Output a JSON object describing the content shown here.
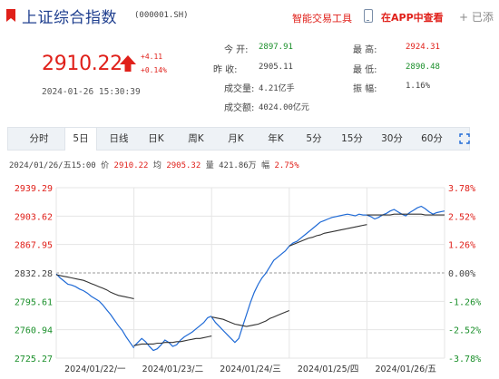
{
  "header": {
    "title": "上证综合指数",
    "code": "(000001.SH)",
    "smart_tool": "智能交易工具",
    "app_link": "在APP中查看",
    "add_label": "+ 已添"
  },
  "quote": {
    "price": "2910.22",
    "change": "+4.11",
    "change_pct": "+0.14%",
    "datetime": "2024-01-26 15:30:39",
    "stats": {
      "open_label": "今    开:",
      "open_value": "2897.91",
      "high_label": "最    高:",
      "high_value": "2924.31",
      "prev_close_label": "昨    收:",
      "prev_close_value": "2905.11",
      "low_label": "最    低:",
      "low_value": "2890.48",
      "volume_label": "成交量:",
      "volume_value": "4.21亿手",
      "amplitude_label": "振    幅:",
      "amplitude_value": "1.16%",
      "turnover_label": "成交额:",
      "turnover_value": "4024.00亿元"
    }
  },
  "tabs": [
    {
      "label": "分时",
      "active": false
    },
    {
      "label": "5日",
      "active": true
    },
    {
      "label": "日线",
      "active": false
    },
    {
      "label": "日K",
      "active": false
    },
    {
      "label": "周K",
      "active": false
    },
    {
      "label": "月K",
      "active": false
    },
    {
      "label": "年K",
      "active": false
    },
    {
      "label": "5分",
      "active": false
    },
    {
      "label": "15分",
      "active": false
    },
    {
      "label": "30分",
      "active": false
    },
    {
      "label": "60分",
      "active": false
    }
  ],
  "info_line": {
    "prefix": "2024/01/26/五15:00 价",
    "price": "2910.22",
    "avg_label": "均",
    "avg": "2905.32",
    "vol_label": "量",
    "vol": "421.86万",
    "amp_label": "幅",
    "amp": "2.75%"
  },
  "colors": {
    "up": "#e0201a",
    "down": "#1a8f2a",
    "price_line": "#1f6ad6",
    "avg_line": "#333333",
    "grid": "#e5e5e5"
  },
  "chart_data": {
    "type": "line",
    "x_labels": [
      "2024/01/22/一",
      "2024/01/23/二",
      "2024/01/24/三",
      "2024/01/25/四",
      "2024/01/26/五"
    ],
    "y_ticks_left": [
      "2939.29",
      "2903.62",
      "2867.95",
      "2832.28",
      "2795.61",
      "2760.94",
      "2725.27"
    ],
    "y_ticks_right": [
      "3.78%",
      "2.52%",
      "1.26%",
      "0.00%",
      "-1.26%",
      "-2.52%",
      "-3.78%"
    ],
    "ylim": [
      2725.27,
      2939.29
    ],
    "baseline": 2832.28,
    "series": [
      {
        "role": "price",
        "day_segments": [
          [
            2831,
            2826,
            2822,
            2818,
            2817,
            2815,
            2812,
            2810,
            2807,
            2803,
            2800,
            2797,
            2792,
            2786,
            2780,
            2773,
            2766,
            2760,
            2752,
            2745,
            2738
          ],
          [
            2740,
            2745,
            2750,
            2746,
            2740,
            2735,
            2737,
            2742,
            2748,
            2745,
            2740,
            2742,
            2748,
            2752,
            2755,
            2758,
            2762,
            2766,
            2770,
            2776,
            2778
          ],
          [
            2777,
            2770,
            2765,
            2760,
            2755,
            2750,
            2745,
            2750,
            2765,
            2780,
            2795,
            2808,
            2818,
            2826,
            2832,
            2840,
            2848,
            2852,
            2856,
            2860,
            2866
          ],
          [
            2866,
            2870,
            2872,
            2876,
            2880,
            2884,
            2888,
            2892,
            2896,
            2898,
            2900,
            2902,
            2903,
            2904,
            2905,
            2906,
            2905,
            2904,
            2906,
            2905,
            2905
          ],
          [
            2905,
            2903,
            2900,
            2902,
            2905,
            2907,
            2910,
            2912,
            2909,
            2906,
            2904,
            2908,
            2911,
            2914,
            2916,
            2913,
            2909,
            2906,
            2908,
            2909,
            2910
          ]
        ]
      },
      {
        "role": "average",
        "day_segments": [
          [
            2830,
            2829,
            2828,
            2827,
            2826,
            2825,
            2824,
            2823,
            2821,
            2819,
            2817,
            2815,
            2813,
            2811,
            2808,
            2806,
            2804,
            2803,
            2802,
            2801,
            2800
          ],
          [
            2741,
            2742,
            2743,
            2743,
            2743,
            2743,
            2744,
            2744,
            2745,
            2745,
            2745,
            2746,
            2746,
            2747,
            2748,
            2749,
            2750,
            2750,
            2751,
            2752,
            2753
          ],
          [
            2777,
            2776,
            2775,
            2774,
            2772,
            2770,
            2768,
            2767,
            2766,
            2765,
            2766,
            2767,
            2768,
            2770,
            2772,
            2775,
            2777,
            2779,
            2781,
            2783,
            2785
          ],
          [
            2866,
            2868,
            2870,
            2872,
            2874,
            2876,
            2877,
            2879,
            2880,
            2882,
            2883,
            2884,
            2885,
            2886,
            2887,
            2888,
            2889,
            2890,
            2891,
            2892,
            2893
          ],
          [
            2905,
            2905,
            2905,
            2905,
            2905,
            2905,
            2905,
            2906,
            2906,
            2906,
            2906,
            2906,
            2906,
            2906,
            2906,
            2905,
            2905,
            2905,
            2905,
            2905,
            2905
          ]
        ]
      }
    ]
  }
}
